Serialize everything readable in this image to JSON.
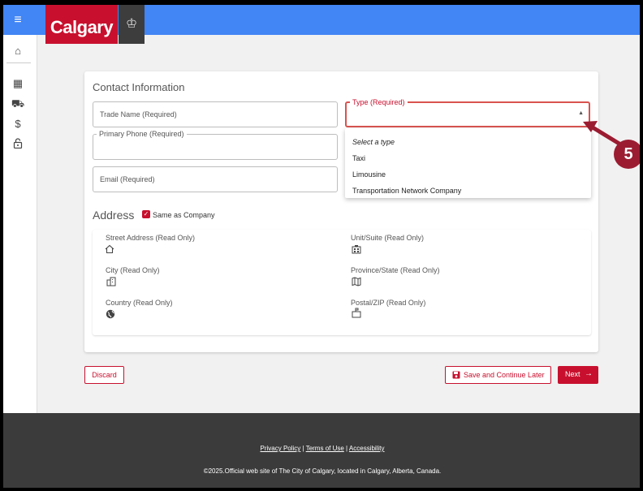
{
  "brand": {
    "name": "Calgary",
    "crest": "city-crest",
    "color": "#c8102e",
    "topbar_color": "#4285f4"
  },
  "sidebar": {
    "items": [
      {
        "icon": "home-icon",
        "glyph": "⌂"
      },
      {
        "icon": "building-icon",
        "glyph": "▦"
      },
      {
        "icon": "taxi-icon",
        "glyph": "⛟"
      },
      {
        "icon": "dollar-icon",
        "glyph": "$"
      },
      {
        "icon": "lock-icon",
        "glyph": "🔓"
      }
    ]
  },
  "contact": {
    "title": "Contact Information",
    "trade_name": "Trade Name (Required)",
    "primary_phone": "Primary Phone (Required)",
    "email": "Email (Required)",
    "type_label": "Type (Required)",
    "type_options": [
      "Select a type",
      "Taxi",
      "Limousine",
      "Transportation Network Company"
    ]
  },
  "callout": {
    "number": "5"
  },
  "address": {
    "title": "Address",
    "same_as_company": "Same as Company",
    "same_as_company_checked": true,
    "fields": {
      "street": {
        "label": "Street Address (Read Only)",
        "icon": "home-outline-icon"
      },
      "unit": {
        "label": "Unit/Suite (Read Only)",
        "icon": "apartment-icon"
      },
      "city": {
        "label": "City (Read Only)",
        "icon": "city-icon"
      },
      "province": {
        "label": "Province/State (Read Only)",
        "icon": "map-icon"
      },
      "country": {
        "label": "Country (Read Only)",
        "icon": "globe-icon"
      },
      "postal": {
        "label": "Postal/ZIP (Read Only)",
        "icon": "mailbox-icon"
      }
    }
  },
  "actions": {
    "discard": "Discard",
    "save_later": "Save and Continue Later",
    "next": "Next"
  },
  "footer": {
    "privacy": "Privacy Policy",
    "terms": "Terms of Use",
    "accessibility": "Accessibility",
    "copyright": "©2025.Official web site of The City of Calgary, located in Calgary, Alberta, Canada."
  }
}
